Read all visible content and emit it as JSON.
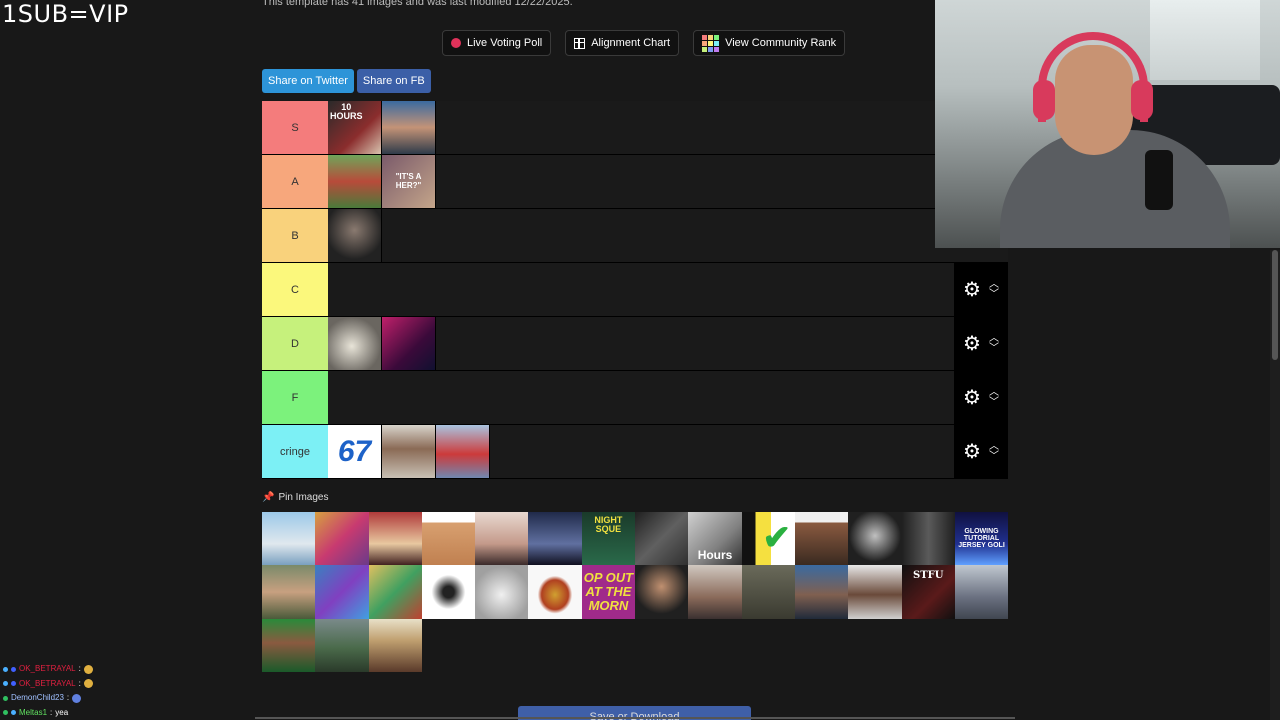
{
  "overlay": {
    "vip_text": "1SUB=VIP"
  },
  "template_info": "This template has 41 images and was last modified 12/22/2025.",
  "top_buttons": {
    "live_poll": "Live Voting Poll",
    "alignment": "Alignment Chart",
    "community": "View Community Rank"
  },
  "share": {
    "twitter": "Share on Twitter",
    "fb": "Share on FB"
  },
  "tiers": [
    {
      "label": "S",
      "color": "#f47c7c"
    },
    {
      "label": "A",
      "color": "#f7a77c"
    },
    {
      "label": "B",
      "color": "#f9d27c"
    },
    {
      "label": "C",
      "color": "#fbf87c"
    },
    {
      "label": "D",
      "color": "#c6f17c"
    },
    {
      "label": "F",
      "color": "#7cf27c"
    },
    {
      "label": "cringe",
      "color": "#7cf0f5"
    }
  ],
  "thumb_texts": {
    "s1": "10\nHOURS",
    "a2": "\"IT'S A\nHER?\"",
    "cringe1": "67"
  },
  "pin_label": "Pin Images",
  "pool_texts": {
    "night_squad": "NIGHT SQUE",
    "hours": "Hours",
    "tutorial": "GLOWING TUTORIAL JERSEY GOLI",
    "opout": "OP OUT AT THE MORN",
    "stfu": "STFU"
  },
  "chat": [
    {
      "user": "OK_BETRAYAL",
      "msg": "",
      "color": "#e02040"
    },
    {
      "user": "OK_BETRAYAL",
      "msg": "",
      "color": "#e02040"
    },
    {
      "user": "DemonChild23",
      "msg": "",
      "color": "#a0c0ff"
    },
    {
      "user": "Meltas1",
      "msg": "yea",
      "color": "#60e060"
    }
  ],
  "save_button": "Save or Download"
}
